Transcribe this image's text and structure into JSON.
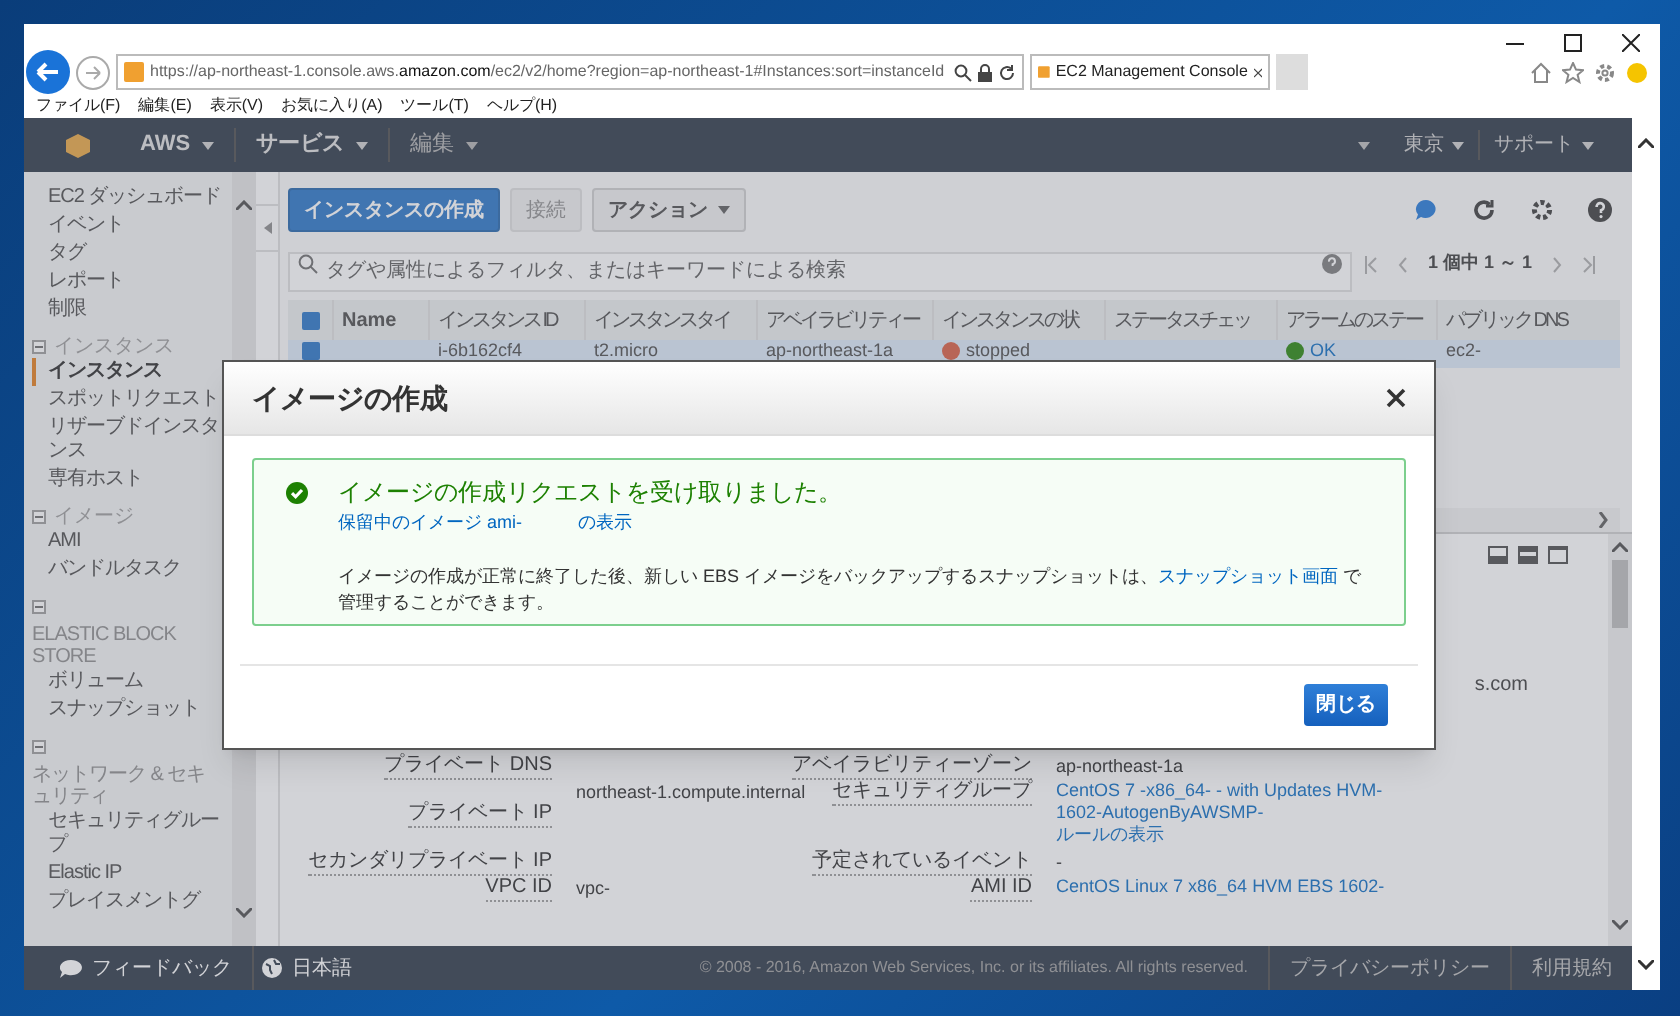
{
  "browser": {
    "url": "https://ap-northeast-1.console.aws.**amazon.com**/ec2/v2/home?region=ap-northeast-1#Instances:sort=instanceId",
    "tab": {
      "title": "EC2 Management Console"
    },
    "menu": [
      "ファイル(F)",
      "編集(E)",
      "表示(V)",
      "お気に入り(A)",
      "ツール(T)",
      "ヘルプ(H)"
    ]
  },
  "top_nav": {
    "left": [
      {
        "label": "AWS",
        "disabled": false
      },
      {
        "label": "サービス",
        "disabled": false
      },
      {
        "label": "編集",
        "disabled": true
      }
    ],
    "right": [
      "東京",
      "サポート"
    ]
  },
  "sidebar": {
    "sections": [
      {
        "kind": "plain",
        "items": [
          {
            "label": "EC2 ダッシュボード",
            "selected": false
          },
          {
            "label": "イベント",
            "selected": false
          },
          {
            "label": "タグ",
            "selected": false
          },
          {
            "label": "レポート",
            "selected": false
          },
          {
            "label": "制限",
            "selected": false
          }
        ]
      },
      {
        "kind": "inline",
        "heading": "インスタンス",
        "items": [
          {
            "label": "インスタンス",
            "selected": true
          },
          {
            "label": "スポットリクエスト",
            "selected": false
          },
          {
            "label": "リザーブドインスタンス",
            "selected": false
          },
          {
            "label": "専有ホスト",
            "selected": false
          }
        ]
      },
      {
        "kind": "inline",
        "heading": "イメージ",
        "items": [
          {
            "label": "AMI",
            "selected": false
          },
          {
            "label": "バンドルタスク",
            "selected": false
          }
        ]
      },
      {
        "kind": "stacked",
        "heading": "ELASTIC BLOCK STORE",
        "items": [
          {
            "label": "ボリューム",
            "selected": false
          },
          {
            "label": "スナップショット",
            "selected": false
          }
        ]
      },
      {
        "kind": "stacked",
        "heading": "ネットワーク & セキュリティ",
        "items": [
          {
            "label": "セキュリティグループ",
            "selected": false
          },
          {
            "label": "Elastic IP",
            "selected": false
          },
          {
            "label": "プレイスメントグ",
            "selected": false
          }
        ]
      }
    ]
  },
  "toolbar": {
    "buttons": [
      {
        "label": "インスタンスの作成",
        "kind": "primary"
      },
      {
        "label": "接続",
        "kind": "disabled"
      },
      {
        "label": "アクション",
        "kind": "dropdown"
      }
    ]
  },
  "search": {
    "placeholder": "タグや属性によるフィルタ、またはキーワードによる検索"
  },
  "pagination": "1 個中 1 ～ 1",
  "table": {
    "header_checkbox": {
      "checked": true
    },
    "columns": [
      "Name",
      "インスタンス ID",
      "インスタンスタイ",
      "アベイラビリティー",
      "インスタンスの状",
      "ステータスチェッ",
      "アラームのステー",
      "パブリック DNS"
    ],
    "rows": [
      {
        "selected": true,
        "instance_id": "i-6b162cf4",
        "instance_type": "t2.micro",
        "availability_zone": "ap-northeast-1a",
        "state": "stopped",
        "alarm_status": "OK",
        "public_dns": "ec2-"
      }
    ]
  },
  "details": {
    "fragment": "s.com",
    "left": [
      {
        "label": "プライベート DNS",
        "value": "northeast-1.compute.internal",
        "kind": "below"
      },
      {
        "label": "プライベート IP"
      },
      {
        "label": "セカンダリプライベート IP"
      },
      {
        "label": "VPC ID",
        "value": "vpc-",
        "kind": "plain"
      }
    ],
    "right": [
      {
        "label": "アベイラビリティーゾーン",
        "value": "ap-northeast-1a",
        "kind": "plain"
      },
      {
        "label": "セキュリティグループ",
        "value": "CentOS 7 -x86_64- - with Updates HVM-1602-AutogenByAWSMP-",
        "extra": "ルールの表示",
        "kind": "link"
      },
      {
        "label": "予定されているイベント",
        "value": "-",
        "kind": "plain"
      },
      {
        "label": "AMI ID",
        "value": "CentOS Linux 7 x86_64 HVM EBS 1602-",
        "kind": "link"
      }
    ]
  },
  "footer": {
    "feedback": "フィードバック",
    "language": "日本語",
    "copyright": "© 2008 - 2016, Amazon Web Services, Inc. or its affiliates. All rights reserved.",
    "links": [
      "プライバシーポリシー",
      "利用規約"
    ]
  },
  "modal": {
    "title": "イメージの作成",
    "heading": "イメージの作成リクエストを受け取りました。",
    "link_parts": [
      "保留中のイメージ ami-",
      "の表示"
    ],
    "body_before": "イメージの作成が正常に終了した後、新しい EBS イメージをバックアップするスナップショットは、",
    "body_link": "スナップショット画面",
    "body_after": " で管理することができます。",
    "button": "閉じる"
  }
}
